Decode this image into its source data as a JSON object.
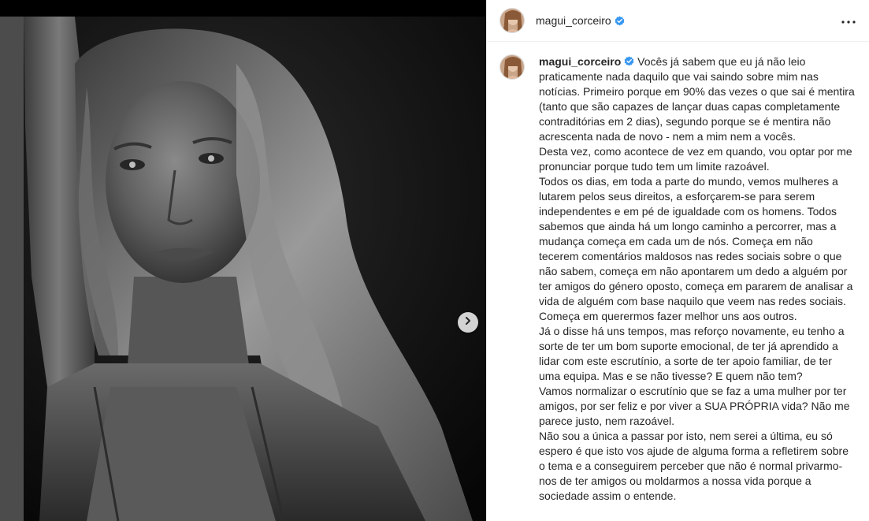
{
  "post": {
    "username": "magui_corceiro",
    "verified": true,
    "more_icon": "more-horizontal-icon",
    "next_icon": "chevron-right-icon"
  },
  "caption": {
    "username": "magui_corceiro",
    "first": "Vocês já sabem que eu já não leio praticamente nada daquilo que vai saindo sobre mim nas notícias. Primeiro porque em 90% das vezes o que sai é mentira (tanto que são capazes de lançar duas capas completamente contraditórias em 2 dias), segundo porque se é mentira não acrescenta nada de novo - nem a mim nem a vocês.",
    "p2": "Desta vez, como acontece de vez em quando, vou optar por me pronunciar porque tudo tem um limite razoável.",
    "p3": "Todos os dias, em toda a parte do mundo, vemos mulheres a lutarem pelos seus direitos, a esforçarem-se para serem independentes e em pé de igualdade com os homens. Todos sabemos que ainda há um longo caminho a percorrer, mas a mudança começa em cada um de nós. Começa em não tecerem comentários maldosos nas redes sociais sobre o que não sabem, começa em não apontarem um dedo a alguém por ter amigos do género oposto, começa em pararem de analisar a vida de alguém com base naquilo que veem nas redes sociais. Começa em querermos fazer melhor uns aos outros.",
    "p4": "Já o disse há uns tempos, mas reforço novamente, eu tenho a sorte de ter um bom suporte emocional, de ter já aprendido a lidar com este escrutínio, a sorte de ter apoio familiar, de ter uma equipa. Mas e se não tivesse? E quem não tem?",
    "p5": "Vamos normalizar o escrutínio que se faz a uma mulher por ter amigos, por ser feliz e por viver a SUA PRÓPRIA vida? Não me parece justo, nem razoável.",
    "p6": "Não sou a única a passar por isto, nem serei a última, eu só espero é que isto vos ajude de alguma forma a refletirem sobre o tema e a conseguirem perceber que não é normal privarmo-nos de ter amigos ou moldarmos a nossa vida porque a sociedade assim o entende."
  },
  "colors": {
    "verified_blue": "#3897f0",
    "text": "#262626",
    "divider": "#efefef"
  }
}
